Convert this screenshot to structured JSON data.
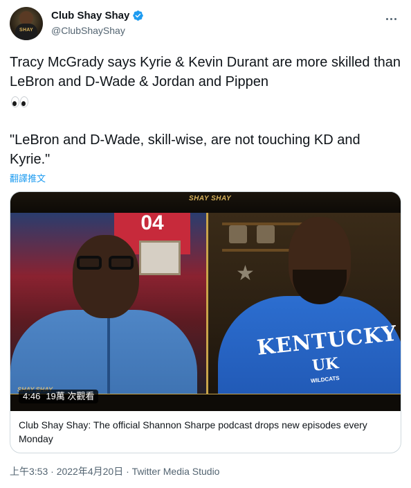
{
  "author": {
    "display_name": "Club Shay Shay",
    "handle": "@ClubShayShay",
    "avatar_text": "SHAY",
    "verified": true
  },
  "tweet": {
    "text": "Tracy McGrady says Kyrie & Kevin Durant are more skilled than LeBron and D-Wade & Jordan and Pippen",
    "emoji_icon": "eyes-icon",
    "quote": "\"LeBron and D-Wade, skill-wise, are not touching KD and Kyrie.\"",
    "translate_label": "翻譯推文"
  },
  "media": {
    "logo_text": "SHAY SHAY",
    "jersey_number": "04",
    "shirt_text": "KENTUCKY",
    "shirt_logo": "UK",
    "shirt_subtext": "WILDCATS",
    "watermark_text": "SHAY SHAY",
    "duration": "4:46",
    "views": "19萬 次觀看",
    "caption": "Club Shay Shay: The official Shannon Sharpe podcast drops new episodes every Monday"
  },
  "meta": {
    "timestamp": "上午3:53 · 2022年4月20日 · Twitter Media Studio"
  },
  "colors": {
    "accent": "#1d9bf0",
    "text_primary": "#0f1419",
    "text_secondary": "#536471",
    "gold": "#c9a44a"
  }
}
